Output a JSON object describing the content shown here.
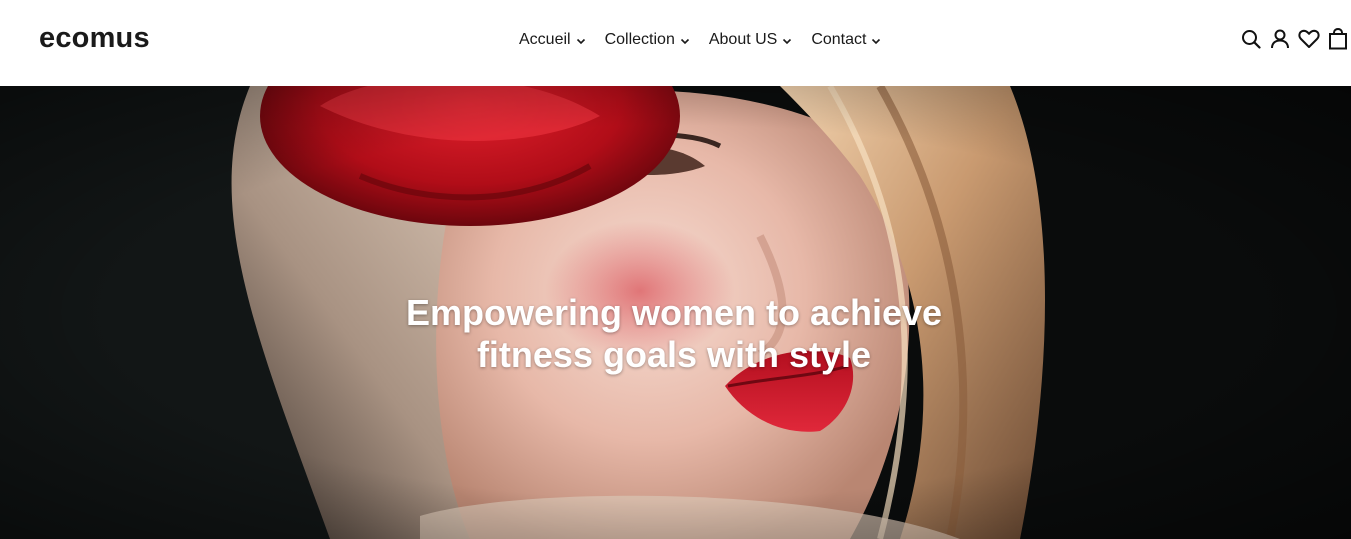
{
  "brand": {
    "logo_text": "ecomus"
  },
  "nav": {
    "items": [
      {
        "label": "Accueil",
        "icon": "chevron-down-icon"
      },
      {
        "label": "Collection",
        "icon": "chevron-down-icon"
      },
      {
        "label": "About US",
        "icon": "chevron-down-icon"
      },
      {
        "label": "Contact",
        "icon": "chevron-down-icon"
      }
    ]
  },
  "header_icons": [
    "search-icon",
    "user-icon",
    "heart-icon",
    "cart-icon"
  ],
  "hero": {
    "title_line1": "Empowering women to achieve",
    "title_line2": "fitness goals with style",
    "image": "woman with red rose and blonde hair, red lips, dark background"
  },
  "colors": {
    "text": "#1a1a1a",
    "hero_text": "#ffffff",
    "accent_red": "#c8101e"
  }
}
